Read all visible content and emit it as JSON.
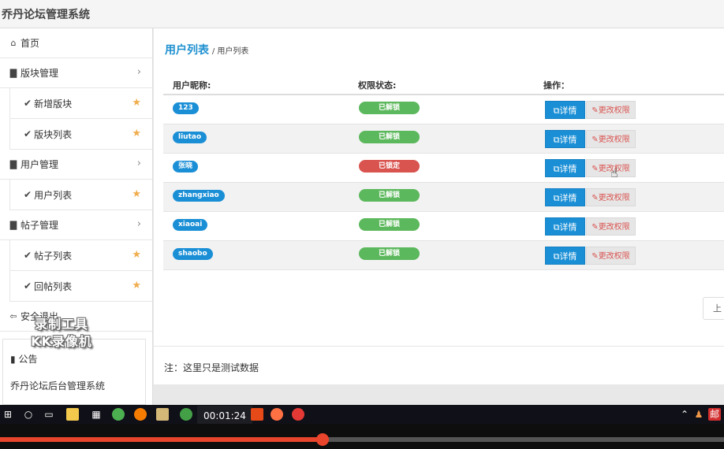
{
  "app": {
    "title": "乔丹论坛管理系统"
  },
  "sidebar": {
    "home": "首页",
    "groups": [
      {
        "label": "版块管理",
        "items": [
          "新增版块",
          "版块列表"
        ]
      },
      {
        "label": "用户管理",
        "items": [
          "用户列表"
        ]
      },
      {
        "label": "帖子管理",
        "items": [
          "帖子列表",
          "回帖列表"
        ]
      }
    ],
    "logout": "安全退出",
    "notice": {
      "title": "公告",
      "text": "乔丹论坛后台管理系统"
    }
  },
  "watermark": {
    "line1": "录制工具",
    "line2": "KK录像机"
  },
  "main": {
    "title": "用户列表",
    "breadcrumb": "/ 用户列表",
    "columns": [
      "用户昵称:",
      "权限状态:",
      "操作："
    ],
    "rows": [
      {
        "nickname": "123",
        "status": "已解锁",
        "status_type": "ok"
      },
      {
        "nickname": "liutao",
        "status": "已解锁",
        "status_type": "ok"
      },
      {
        "nickname": "张晓",
        "status": "已锁定",
        "status_type": "locked"
      },
      {
        "nickname": "zhangxiao",
        "status": "已解锁",
        "status_type": "ok"
      },
      {
        "nickname": "xiaoai",
        "status": "已解锁",
        "status_type": "ok"
      },
      {
        "nickname": "shaobo",
        "status": "已解锁",
        "status_type": "ok"
      }
    ],
    "detail_label": "详情",
    "perm_label": "更改权限",
    "pager_prev": "上",
    "footnote": "注：这里只是测试数据"
  },
  "taskbar": {
    "time": "00:01:24"
  },
  "video": {
    "progress": 0.445
  },
  "colors": {
    "accent": "#1a8fd6",
    "ok": "#5cb85c",
    "locked": "#d9534f",
    "star": "#f0ad4e"
  }
}
